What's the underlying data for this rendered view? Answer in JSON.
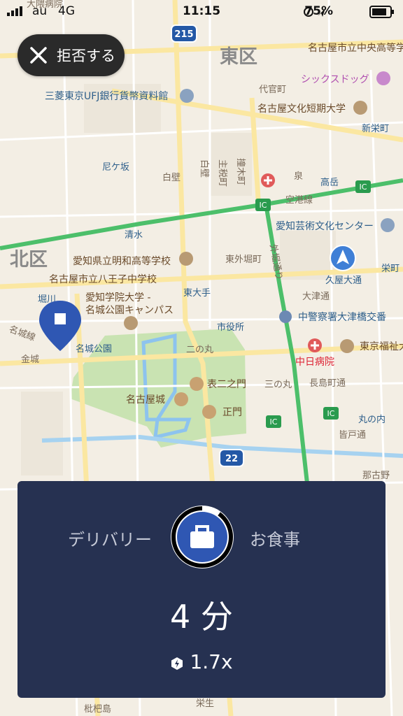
{
  "status_bar": {
    "carrier": "au",
    "network": "4G",
    "time": "11:15",
    "battery": "75%"
  },
  "reject_button": {
    "label": "拒否する"
  },
  "map": {
    "districts": [
      "東区",
      "北区"
    ],
    "routes": [
      "215",
      "22"
    ],
    "labels": {
      "hospital_top": "大隈病院",
      "school_chuo": "名古屋市立中央高等学校",
      "shop": "シックスドッグ",
      "bank": "三菱東京UFJ銀行貨幣資料館",
      "daikan": "代官町",
      "college": "名古屋文化短期大学",
      "shinsakae": "新栄町",
      "amagasaka": "尼ケ坂",
      "shirakabe": "白壁",
      "shirakabe_v": "白壁",
      "shumoku_v": "主税町",
      "nunoike_v": "撞木町",
      "izumi": "泉",
      "takaoka": "高岳",
      "kuukou": "空港線",
      "shimizu": "清水",
      "art_center": "愛知芸術文化センター",
      "meiwa": "愛知県立明和高等学校",
      "sotobori_street": "東外堀町",
      "sotobori_v": "外堀通り",
      "hisaya": "久屋大通",
      "sakae": "栄町",
      "hachioji": "名古屋市立八王子中学校",
      "higashiote": "東大手",
      "horikawa": "堀川",
      "aichi_gakuin1": "愛知学院大学 -",
      "aichi_gakuin2": "名城公園キャンパス",
      "otsu": "大津通",
      "police": "中警察署大津橋交番",
      "meijo_line": "名城線",
      "shiyakusho": "市役所",
      "meijokoen": "名城公園",
      "ninomaru": "二の丸",
      "tokyo_fukushi": "東京福祉大",
      "chunichi": "中日病院",
      "kinjo": "金城",
      "omote": "表二之門",
      "sannomaru": "三の丸",
      "nagashima": "長島町通",
      "nagoya_castle": "名古屋城",
      "seimon": "正門",
      "marunouchi": "丸の内",
      "minamai": "皆戸通",
      "nagoya_no": "那古野",
      "ic": "IC",
      "bottom1": "枇杷島",
      "bottom2": "栄生"
    }
  },
  "offer_card": {
    "left_label": "デリバリー",
    "right_label": "お食事",
    "eta": "4 分",
    "surge": "1.7x",
    "timer_fraction": 0.9
  }
}
